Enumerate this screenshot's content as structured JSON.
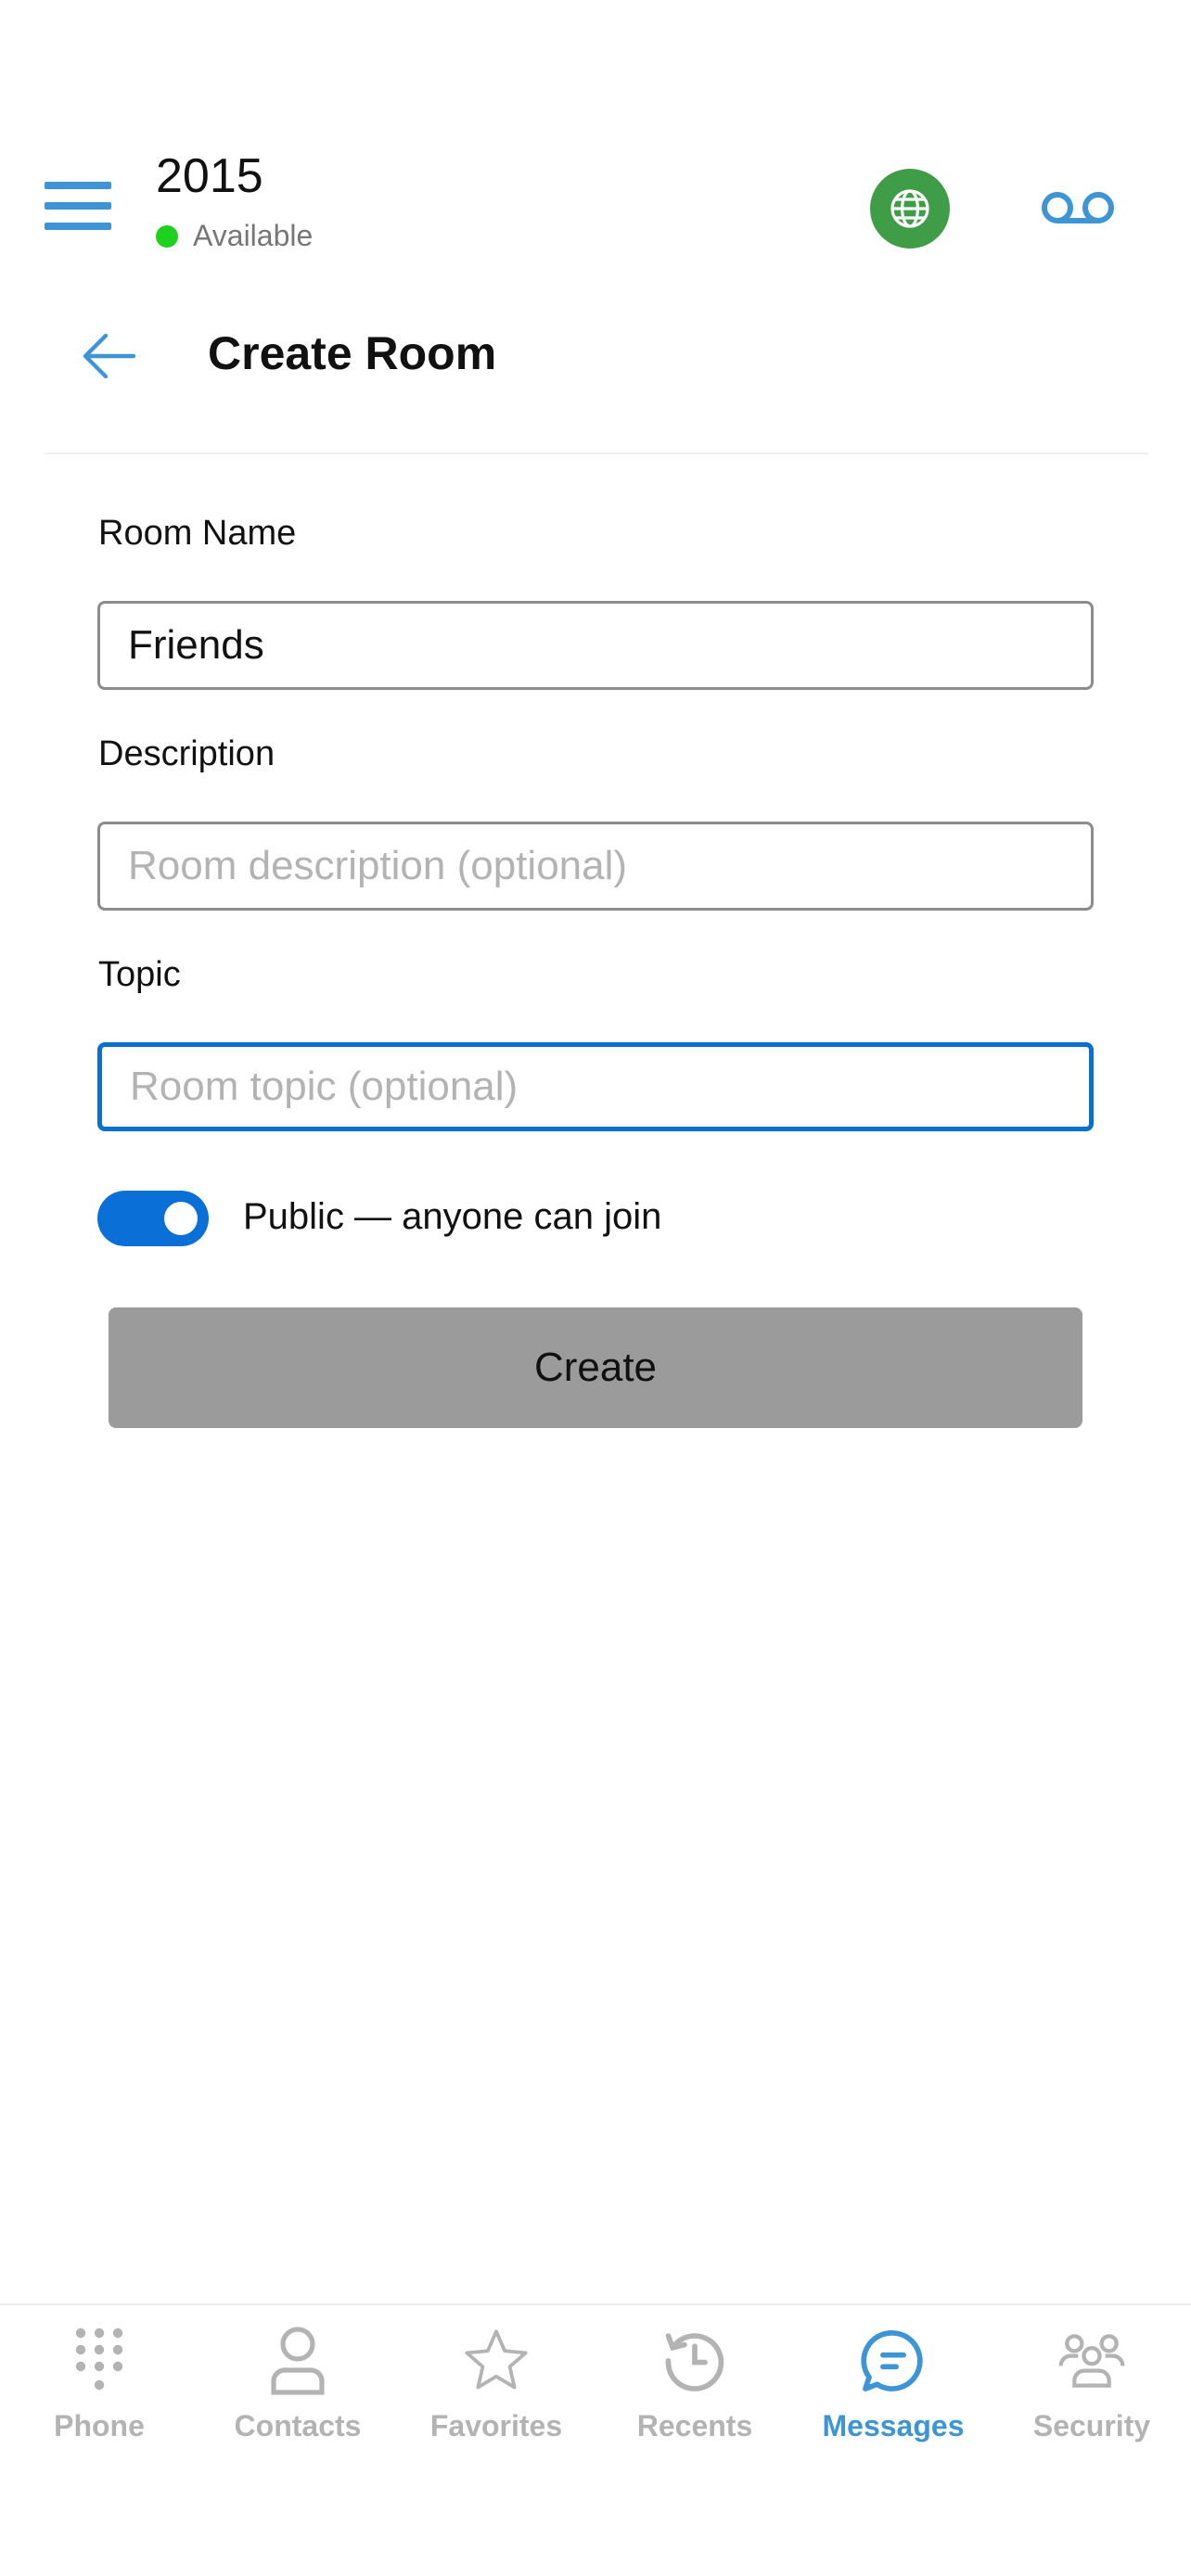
{
  "header": {
    "extension": "2015",
    "status_text": "Available",
    "status_color": "#1fd11f",
    "icons": [
      "hamburger-menu-icon",
      "globe-icon",
      "voicemail-icon"
    ]
  },
  "page": {
    "title": "Create Room",
    "back_icon": "arrow-left-icon"
  },
  "form": {
    "room_name": {
      "label": "Room Name",
      "value": "Friends",
      "placeholder": ""
    },
    "description": {
      "label": "Description",
      "value": "",
      "placeholder": "Room description (optional)"
    },
    "topic": {
      "label": "Topic",
      "value": "",
      "placeholder": "Room topic (optional)"
    },
    "public_toggle": {
      "label": "Public — anyone can join",
      "on": true
    },
    "submit_label": "Create"
  },
  "nav": {
    "items": [
      {
        "label": "Phone",
        "icon": "dialpad-icon",
        "active": false
      },
      {
        "label": "Contacts",
        "icon": "person-icon",
        "active": false
      },
      {
        "label": "Favorites",
        "icon": "star-icon",
        "active": false
      },
      {
        "label": "Recents",
        "icon": "history-icon",
        "active": false
      },
      {
        "label": "Messages",
        "icon": "chat-bubble-icon",
        "active": true
      },
      {
        "label": "Security",
        "icon": "group-icon",
        "active": false
      }
    ]
  },
  "colors": {
    "accent": "#3d95d6",
    "focus_border": "#0a6fcf",
    "toggle_on": "#0a6fd6",
    "globe_bg": "#3f9c47",
    "create_button_bg": "#9b9b9b",
    "nav_inactive": "#b3b3b3"
  }
}
